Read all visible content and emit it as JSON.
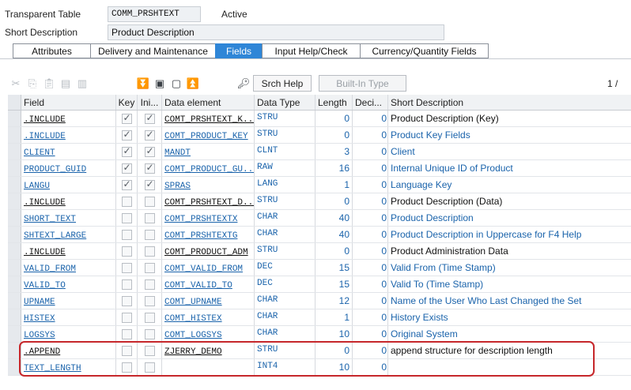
{
  "header": {
    "table_label": "Transparent Table",
    "table_name": "COMM_PRSHTEXT",
    "status": "Active",
    "short_desc_label": "Short Description",
    "short_desc_value": "Product Description"
  },
  "tabs": [
    {
      "label": "Attributes",
      "active": false
    },
    {
      "label": "Delivery and Maintenance",
      "active": false
    },
    {
      "label": "Fields",
      "active": true
    },
    {
      "label": "Input Help/Check",
      "active": false
    },
    {
      "label": "Currency/Quantity Fields",
      "active": false
    }
  ],
  "toolbar": {
    "icons": [
      "cut-icon",
      "copy-icon",
      "paste-icon",
      "insert-row-icon",
      "delete-row-icon",
      "collapse-icon",
      "expand-icon",
      "select-all-icon",
      "deselect-icon",
      "new-field-icon"
    ],
    "srch_help": "Srch Help",
    "built_in_type": "Built-In Type",
    "pager": "1 /"
  },
  "columns": [
    "Field",
    "Key",
    "Ini...",
    "Data element",
    "Data Type",
    "Length",
    "Deci...",
    "Short Description"
  ],
  "rows": [
    {
      "field": ".INCLUDE",
      "key": true,
      "ini": true,
      "de": "COMT_PRSHTEXT_K...",
      "dt": "STRU",
      "len": "0",
      "dec": "0",
      "desc": "Product Description (Key)",
      "field_style": "lnk-black",
      "de_style": "lnk-black",
      "desc_style": "dark"
    },
    {
      "field": ".INCLUDE",
      "key": true,
      "ini": true,
      "de": "COMT_PRODUCT_KEY",
      "dt": "STRU",
      "len": "0",
      "dec": "0",
      "desc": "Product Key Fields",
      "field_style": "lnk",
      "de_style": "lnk",
      "desc_style": "blue"
    },
    {
      "field": "CLIENT",
      "key": true,
      "ini": true,
      "de": "MANDT",
      "dt": "CLNT",
      "len": "3",
      "dec": "0",
      "desc": "Client",
      "field_style": "lnk",
      "de_style": "lnk",
      "desc_style": "blue"
    },
    {
      "field": "PRODUCT_GUID",
      "key": true,
      "ini": true,
      "de": "COMT_PRODUCT_GU...",
      "dt": "RAW",
      "len": "16",
      "dec": "0",
      "desc": "Internal Unique ID of Product",
      "field_style": "lnk",
      "de_style": "lnk",
      "desc_style": "blue"
    },
    {
      "field": "LANGU",
      "key": true,
      "ini": true,
      "de": "SPRAS",
      "dt": "LANG",
      "len": "1",
      "dec": "0",
      "desc": "Language Key",
      "field_style": "lnk",
      "de_style": "lnk",
      "desc_style": "blue"
    },
    {
      "field": ".INCLUDE",
      "key": false,
      "ini": false,
      "de": "COMT_PRSHTEXT_D...",
      "dt": "STRU",
      "len": "0",
      "dec": "0",
      "desc": "Product Description (Data)",
      "field_style": "lnk-black",
      "de_style": "lnk-black",
      "desc_style": "dark"
    },
    {
      "field": "SHORT_TEXT",
      "key": false,
      "ini": false,
      "de": "COMT_PRSHTEXTX",
      "dt": "CHAR",
      "len": "40",
      "dec": "0",
      "desc": "Product Description",
      "field_style": "lnk",
      "de_style": "lnk",
      "desc_style": "blue"
    },
    {
      "field": "SHTEXT_LARGE",
      "key": false,
      "ini": false,
      "de": "COMT_PRSHTEXTG",
      "dt": "CHAR",
      "len": "40",
      "dec": "0",
      "desc": "Product Description in Uppercase for F4 Help",
      "field_style": "lnk",
      "de_style": "lnk",
      "desc_style": "blue"
    },
    {
      "field": ".INCLUDE",
      "key": false,
      "ini": false,
      "de": "COMT_PRODUCT_ADM",
      "dt": "STRU",
      "len": "0",
      "dec": "0",
      "desc": "Product Administration Data",
      "field_style": "lnk-black",
      "de_style": "lnk-black",
      "desc_style": "dark"
    },
    {
      "field": "VALID_FROM",
      "key": false,
      "ini": false,
      "de": "COMT_VALID_FROM",
      "dt": "DEC",
      "len": "15",
      "dec": "0",
      "desc": "Valid From (Time Stamp)",
      "field_style": "lnk",
      "de_style": "lnk",
      "desc_style": "blue"
    },
    {
      "field": "VALID_TO",
      "key": false,
      "ini": false,
      "de": "COMT_VALID_TO",
      "dt": "DEC",
      "len": "15",
      "dec": "0",
      "desc": "Valid To (Time Stamp)",
      "field_style": "lnk",
      "de_style": "lnk",
      "desc_style": "blue"
    },
    {
      "field": "UPNAME",
      "key": false,
      "ini": false,
      "de": "COMT_UPNAME",
      "dt": "CHAR",
      "len": "12",
      "dec": "0",
      "desc": "Name of the User Who Last Changed the Set",
      "field_style": "lnk",
      "de_style": "lnk",
      "desc_style": "blue"
    },
    {
      "field": "HISTEX",
      "key": false,
      "ini": false,
      "de": "COMT_HISTEX",
      "dt": "CHAR",
      "len": "1",
      "dec": "0",
      "desc": "History Exists",
      "field_style": "lnk",
      "de_style": "lnk",
      "desc_style": "blue"
    },
    {
      "field": "LOGSYS",
      "key": false,
      "ini": false,
      "de": "COMT_LOGSYS",
      "dt": "CHAR",
      "len": "10",
      "dec": "0",
      "desc": "Original System",
      "field_style": "lnk",
      "de_style": "lnk",
      "desc_style": "blue"
    },
    {
      "field": ".APPEND",
      "key": false,
      "ini": false,
      "de": "ZJERRY_DEMO",
      "dt": "STRU",
      "len": "0",
      "dec": "0",
      "desc": "append structure for description length",
      "field_style": "lnk-black",
      "de_style": "lnk-black",
      "desc_style": "dark"
    },
    {
      "field": "TEXT_LENGTH",
      "key": false,
      "ini": false,
      "de": "",
      "dt": "INT4",
      "len": "10",
      "dec": "0",
      "desc": "",
      "field_style": "lnk",
      "de_style": "lnk",
      "desc_style": "blue"
    }
  ],
  "colors": {
    "tab_active": "#2f86d7",
    "link": "#1a63ab",
    "highlight": "#c6272b"
  }
}
